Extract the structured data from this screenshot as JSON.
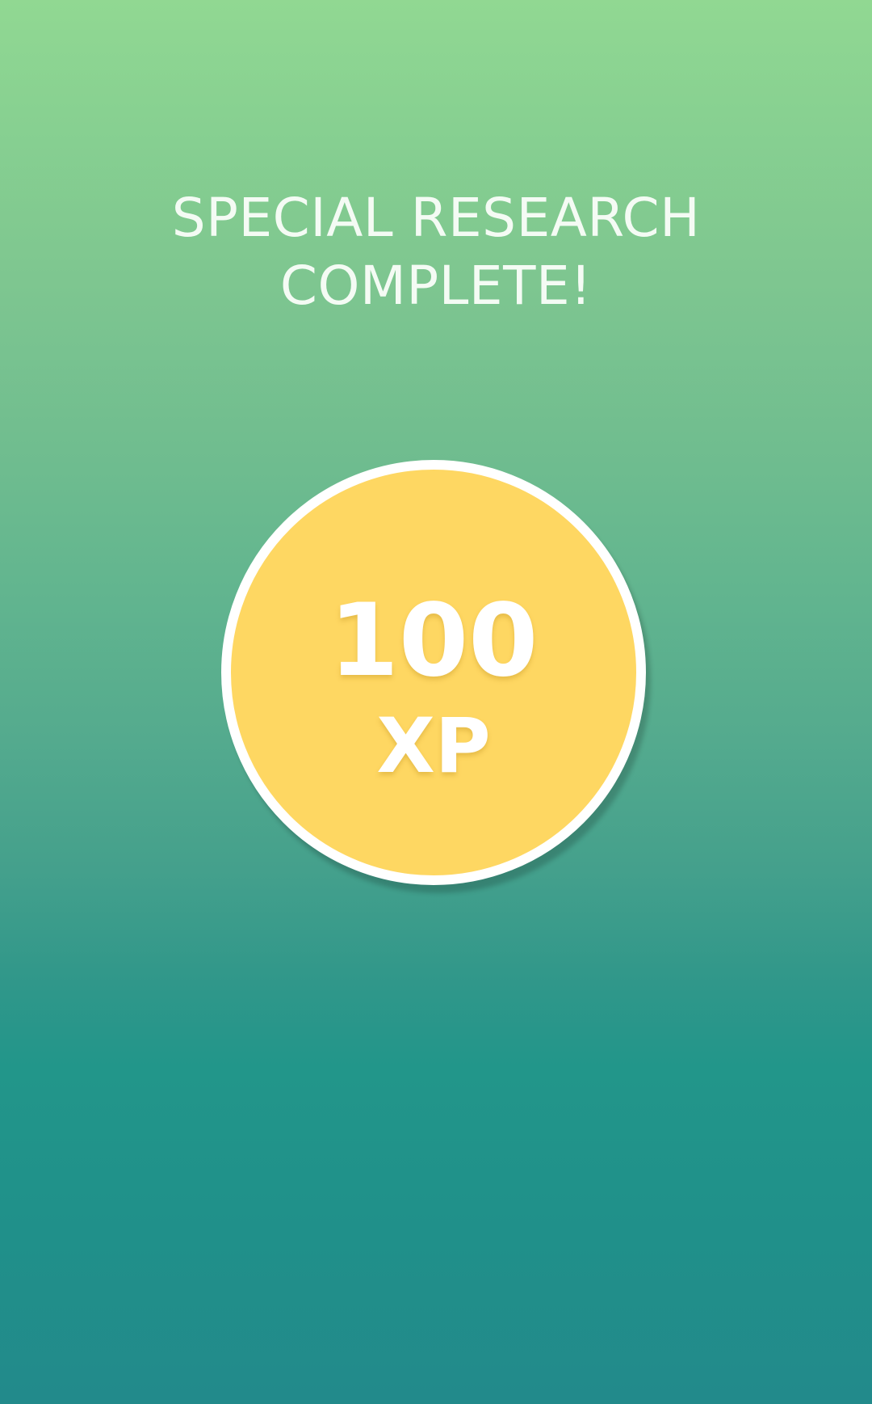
{
  "header": {
    "title_line1": "SPECIAL RESEARCH",
    "title_line2": "COMPLETE!"
  },
  "reward": {
    "amount": "100",
    "unit": "XP"
  },
  "colors": {
    "background_top": "#91d892",
    "background_bottom": "#228a8b",
    "reward_fill": "#fed762",
    "reward_border": "#ffffff",
    "text": "#ffffff"
  }
}
